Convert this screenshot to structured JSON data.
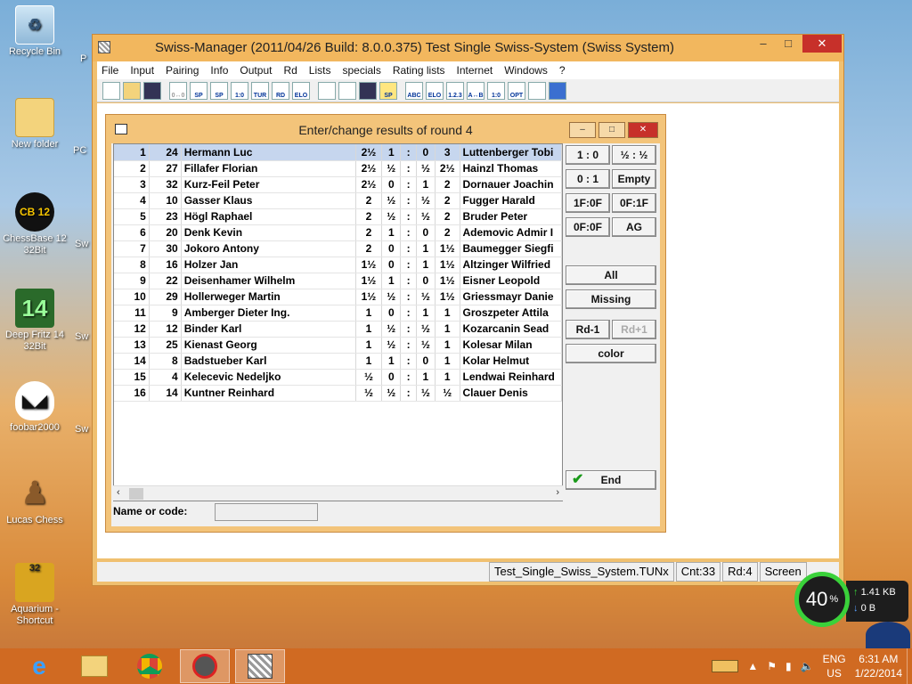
{
  "desktop": {
    "icons": [
      {
        "label": "Recycle Bin",
        "icon": "recycle-bin-icon"
      },
      {
        "label": "New folder",
        "icon": "folder-icon"
      },
      {
        "label": "ChessBase 12\n32Bit",
        "icon": "chessbase-icon",
        "glyph": "CB 12"
      },
      {
        "label": "Deep Fritz 14\n32Bit",
        "icon": "fritz-icon",
        "glyph": "14"
      },
      {
        "label": "foobar2000",
        "icon": "foobar-icon"
      },
      {
        "label": "Lucas Chess",
        "icon": "chess-pawn-icon"
      },
      {
        "label": "Aquarium -\nShortcut",
        "icon": "aquarium-icon",
        "glyph": "32"
      }
    ],
    "partial_labels": [
      "P",
      "PC",
      "Sw",
      "Sw",
      "Sw"
    ]
  },
  "main_window": {
    "title": "Swiss-Manager (2011/04/26 Build: 8.0.0.375)  Test Single Swiss-System    (Swiss System)",
    "controls": {
      "minimize": "–",
      "maximize": "□",
      "close": "✕"
    },
    "menu": [
      "File",
      "Input",
      "Pairing",
      "Info",
      "Output",
      "Rd",
      "Lists",
      "specials",
      "Rating lists",
      "Internet",
      "Windows",
      "?"
    ],
    "toolbar": [
      "",
      "",
      "",
      "0↔0",
      "SP",
      "SP",
      "1:0",
      "TUR",
      "RD",
      "ELO",
      "",
      "",
      "",
      "SP",
      "ABC",
      "ELO",
      "1.2.3",
      "A↔B",
      "1:0",
      "OPT",
      "",
      ""
    ],
    "status": {
      "file": "Test_Single_Swiss_System.TUNx",
      "count": "Cnt:33",
      "round": "Rd:4",
      "screen": "Screen"
    }
  },
  "dialog": {
    "title": "Enter/change results of round 4",
    "rows": [
      {
        "no": "1",
        "id": "24",
        "name": "Hermann Luc",
        "pts1": "2½",
        "r1": "1",
        "r2": "0",
        "pts2": "3",
        "opp": "Luttenberger Tobi"
      },
      {
        "no": "2",
        "id": "27",
        "name": "Fillafer Florian",
        "pts1": "2½",
        "r1": "½",
        "r2": "½",
        "pts2": "2½",
        "opp": "Hainzl Thomas"
      },
      {
        "no": "3",
        "id": "32",
        "name": "Kurz-Feil Peter",
        "pts1": "2½",
        "r1": "0",
        "r2": "1",
        "pts2": "2",
        "opp": "Dornauer Joachin"
      },
      {
        "no": "4",
        "id": "10",
        "name": "Gasser Klaus",
        "pts1": "2",
        "r1": "½",
        "r2": "½",
        "pts2": "2",
        "opp": "Fugger Harald"
      },
      {
        "no": "5",
        "id": "23",
        "name": "Högl Raphael",
        "pts1": "2",
        "r1": "½",
        "r2": "½",
        "pts2": "2",
        "opp": "Bruder Peter"
      },
      {
        "no": "6",
        "id": "20",
        "name": "Denk Kevin",
        "pts1": "2",
        "r1": "1",
        "r2": "0",
        "pts2": "2",
        "opp": "Ademovic Admir I"
      },
      {
        "no": "7",
        "id": "30",
        "name": "Jokoro Antony",
        "pts1": "2",
        "r1": "0",
        "r2": "1",
        "pts2": "1½",
        "opp": "Baumegger Siegfi"
      },
      {
        "no": "8",
        "id": "16",
        "name": "Holzer Jan",
        "pts1": "1½",
        "r1": "0",
        "r2": "1",
        "pts2": "1½",
        "opp": "Altzinger Wilfried"
      },
      {
        "no": "9",
        "id": "22",
        "name": "Deisenhamer Wilhelm",
        "pts1": "1½",
        "r1": "1",
        "r2": "0",
        "pts2": "1½",
        "opp": "Eisner Leopold"
      },
      {
        "no": "10",
        "id": "29",
        "name": "Hollerweger Martin",
        "pts1": "1½",
        "r1": "½",
        "r2": "½",
        "pts2": "1½",
        "opp": "Griessmayr Danie"
      },
      {
        "no": "11",
        "id": "9",
        "name": "Amberger Dieter Ing.",
        "pts1": "1",
        "r1": "0",
        "r2": "1",
        "pts2": "1",
        "opp": "Groszpeter Attila"
      },
      {
        "no": "12",
        "id": "12",
        "name": "Binder Karl",
        "pts1": "1",
        "r1": "½",
        "r2": "½",
        "pts2": "1",
        "opp": "Kozarcanin Sead"
      },
      {
        "no": "13",
        "id": "25",
        "name": "Kienast Georg",
        "pts1": "1",
        "r1": "½",
        "r2": "½",
        "pts2": "1",
        "opp": "Kolesar Milan"
      },
      {
        "no": "14",
        "id": "8",
        "name": "Badstueber Karl",
        "pts1": "1",
        "r1": "1",
        "r2": "0",
        "pts2": "1",
        "opp": "Kolar Helmut"
      },
      {
        "no": "15",
        "id": "4",
        "name": "Kelecevic Nedeljko",
        "pts1": "½",
        "r1": "0",
        "r2": "1",
        "pts2": "1",
        "opp": "Lendwai Reinhard"
      },
      {
        "no": "16",
        "id": "14",
        "name": "Kuntner Reinhard",
        "pts1": "½",
        "r1": "½",
        "r2": "½",
        "pts2": "½",
        "opp": "Clauer Denis"
      }
    ],
    "colon": ":",
    "buttons": {
      "win": "1 : 0",
      "draw": "½ : ½",
      "loss": "0 : 1",
      "empty": "Empty",
      "forfeit_win": "1F:0F",
      "forfeit_loss": "0F:1F",
      "double_forfeit": "0F:0F",
      "ag": "AG",
      "all": "All",
      "missing": "Missing",
      "rd_prev": "Rd-1",
      "rd_next": "Rd+1",
      "color": "color",
      "end": "End"
    },
    "name_label": "Name or code:",
    "name_value": ""
  },
  "net_widget": {
    "percent": "40",
    "percent_sign": "%",
    "upload": "1.41 KB",
    "download": "0 B"
  },
  "taskbar": {
    "lang_top": "ENG",
    "lang_bottom": "US",
    "time": "6:31 AM",
    "date": "1/22/2014"
  },
  "colors": {
    "accent_green": "#3ad13a",
    "selected_row": "#c6d6ee",
    "window_frame": "#f2b75e"
  }
}
